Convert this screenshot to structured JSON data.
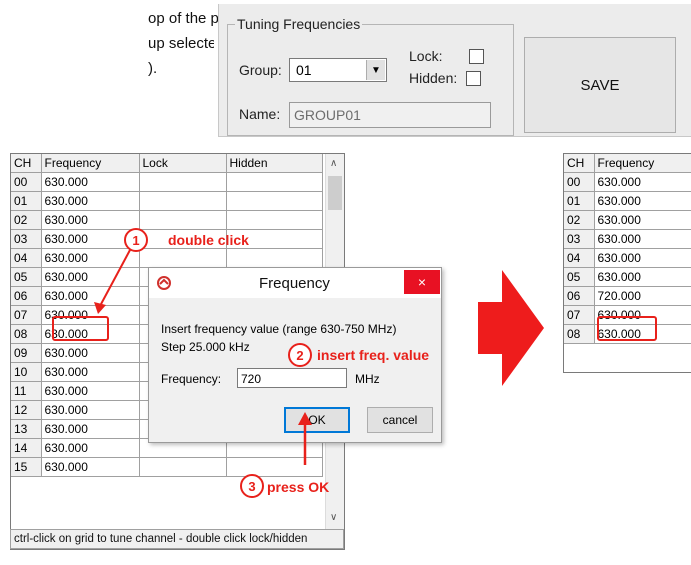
{
  "doc": {
    "line1": "op of the panel, save",
    "line2": "up  selected  (name",
    "line3": ")."
  },
  "panel": {
    "title": "Tuning Frequencies",
    "group_label": "Group:",
    "group_value": "01",
    "lock_label": "Lock:",
    "hidden_label": "Hidden:",
    "name_label": "Name:",
    "name_value": "GROUP01",
    "save_label": "SAVE"
  },
  "grid_left": {
    "headers": [
      "CH",
      "Frequency",
      "Lock",
      "Hidden"
    ],
    "rows": [
      [
        "00",
        "630.000"
      ],
      [
        "01",
        "630.000"
      ],
      [
        "02",
        "630.000"
      ],
      [
        "03",
        "630.000"
      ],
      [
        "04",
        "630.000"
      ],
      [
        "05",
        "630.000"
      ],
      [
        "06",
        "630.000"
      ],
      [
        "07",
        "630.000"
      ],
      [
        "08",
        "630.000"
      ],
      [
        "09",
        "630.000"
      ],
      [
        "10",
        "630.000"
      ],
      [
        "11",
        "630.000"
      ],
      [
        "12",
        "630.000"
      ],
      [
        "13",
        "630.000"
      ],
      [
        "14",
        "630.000"
      ],
      [
        "15",
        "630.000"
      ]
    ],
    "status": "ctrl-click on grid to tune channel - double click lock/hidden"
  },
  "grid_right": {
    "headers": [
      "CH",
      "Frequency"
    ],
    "rows": [
      [
        "00",
        "630.000"
      ],
      [
        "01",
        "630.000"
      ],
      [
        "02",
        "630.000"
      ],
      [
        "03",
        "630.000"
      ],
      [
        "04",
        "630.000"
      ],
      [
        "05",
        "630.000"
      ],
      [
        "06",
        "720.000"
      ],
      [
        "07",
        "630.000"
      ],
      [
        "08",
        "630.000"
      ]
    ]
  },
  "dialog": {
    "title": "Frequency",
    "close": "×",
    "line1": "Insert frequency value (range 630-750 MHz)",
    "line2": "Step 25.000 kHz",
    "freq_label": "Frequency:",
    "freq_value": "720",
    "unit": "MHz",
    "ok": "OK",
    "cancel": "cancel"
  },
  "annotations": {
    "step1_num": "1",
    "step1_text": "double click",
    "step2_num": "2",
    "step2_text": "insert freq. value",
    "step3_num": "3",
    "step3_text": "press OK"
  },
  "colors": {
    "annotation": "#e8211b",
    "accent": "#0078d7"
  }
}
